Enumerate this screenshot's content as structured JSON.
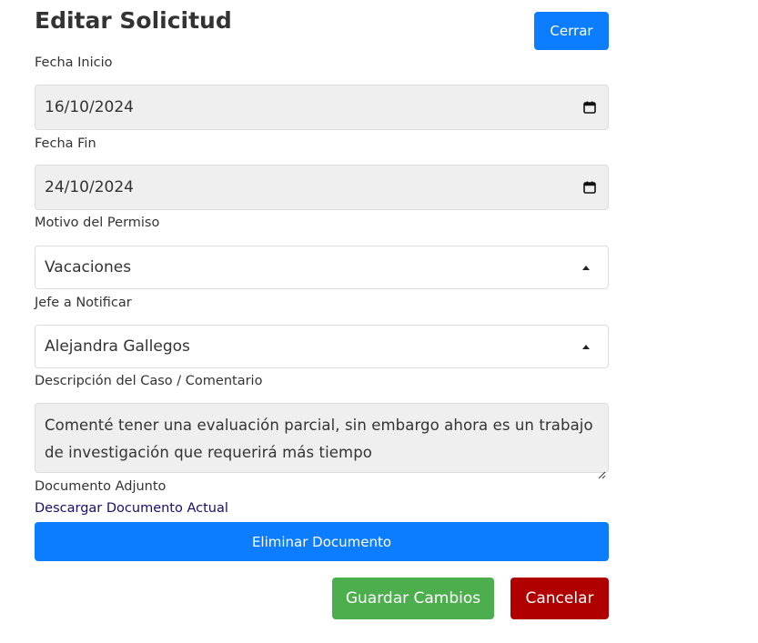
{
  "page": {
    "title": "Editar Solicitud",
    "close_label": "Cerrar"
  },
  "form": {
    "start_date": {
      "label": "Fecha Inicio",
      "value": "16/10/2024",
      "icon": "calendar-icon"
    },
    "end_date": {
      "label": "Fecha Fin",
      "value": "24/10/2024",
      "icon": "calendar-icon"
    },
    "reason": {
      "label": "Motivo del Permiso",
      "value": "Vacaciones",
      "icon": "caret-up-icon"
    },
    "manager": {
      "label": "Jefe a Notificar",
      "value": "Alejandra Gallegos",
      "icon": "caret-up-icon"
    },
    "description": {
      "label": "Descripción del Caso / Comentario",
      "value": "Comenté tener una evaluación parcial, sin embargo ahora es un trabajo de investigación que requerirá más tiempo"
    },
    "attachment": {
      "label": "Documento Adjunto",
      "download_label": "Descargar Documento Actual",
      "delete_label": "Eliminar Documento"
    }
  },
  "actions": {
    "save_label": "Guardar Cambios",
    "cancel_label": "Cancelar"
  },
  "colors": {
    "primary": "#0d7dff",
    "success": "#4cae4c",
    "danger": "#b00000",
    "disabled_bg": "#efefef",
    "link": "#1a0d6b"
  }
}
